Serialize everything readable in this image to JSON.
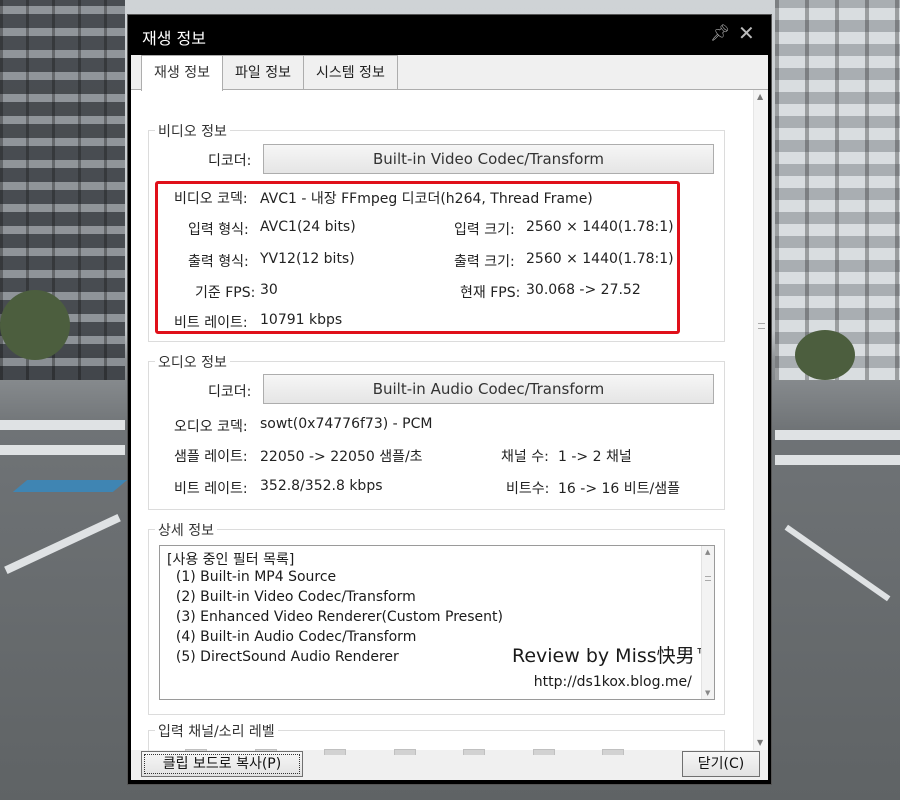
{
  "window": {
    "title": "재생 정보"
  },
  "tabs": [
    {
      "label": "재생 정보",
      "active": true
    },
    {
      "label": "파일 정보",
      "active": false
    },
    {
      "label": "시스템 정보",
      "active": false
    }
  ],
  "video": {
    "group_title": "비디오 정보",
    "decoder_label": "디코더:",
    "decoder_value": "Built-in Video Codec/Transform",
    "codec_label": "비디오 코덱:",
    "codec_value": "AVC1 - 내장 FFmpeg 디코더(h264, Thread Frame)",
    "input_format_label": "입력 형식:",
    "input_format_value": "AVC1(24 bits)",
    "input_size_label": "입력 크기:",
    "input_size_value": "2560 × 1440(1.78:1)",
    "output_format_label": "출력 형식:",
    "output_format_value": "YV12(12 bits)",
    "output_size_label": "출력 크기:",
    "output_size_value": "2560 × 1440(1.78:1)",
    "base_fps_label": "기준 FPS:",
    "base_fps_value": "30",
    "current_fps_label": "현재 FPS:",
    "current_fps_value": "30.068 -> 27.52",
    "bitrate_label": "비트 레이트:",
    "bitrate_value": "10791 kbps"
  },
  "audio": {
    "group_title": "오디오 정보",
    "decoder_label": "디코더:",
    "decoder_value": "Built-in Audio Codec/Transform",
    "codec_label": "오디오 코덱:",
    "codec_value": "sowt(0x74776f73) - PCM",
    "sample_rate_label": "샘플 레이트:",
    "sample_rate_value": "22050 -> 22050 샘플/초",
    "channels_label": "채널 수:",
    "channels_value": "1 -> 2 채널",
    "bitrate_label": "비트 레이트:",
    "bitrate_value": "352.8/352.8 kbps",
    "bits_label": "비트수:",
    "bits_value": "16 -> 16 비트/샘플"
  },
  "details": {
    "group_title": "상세 정보",
    "lines": [
      "[사용 중인 필터 목록]",
      "  (1) Built-in MP4 Source",
      "  (2) Built-in Video Codec/Transform",
      "  (3) Enhanced Video Renderer(Custom Present)",
      "  (4) Built-in Audio Codec/Transform",
      "  (5) DirectSound Audio Renderer"
    ],
    "watermark_title": "Review by Miss快男™",
    "watermark_url": "http://ds1kox.blog.me/"
  },
  "levels": {
    "group_title": "입력 채널/소리 레벨"
  },
  "buttons": {
    "copy_label": "클립 보드로 복사(P)",
    "close_label": "닫기(C)"
  },
  "colors": {
    "highlight_box": "#e0101a",
    "title_bar": "#000000"
  },
  "icons": {
    "pin": "pin-icon",
    "close": "close-icon"
  }
}
